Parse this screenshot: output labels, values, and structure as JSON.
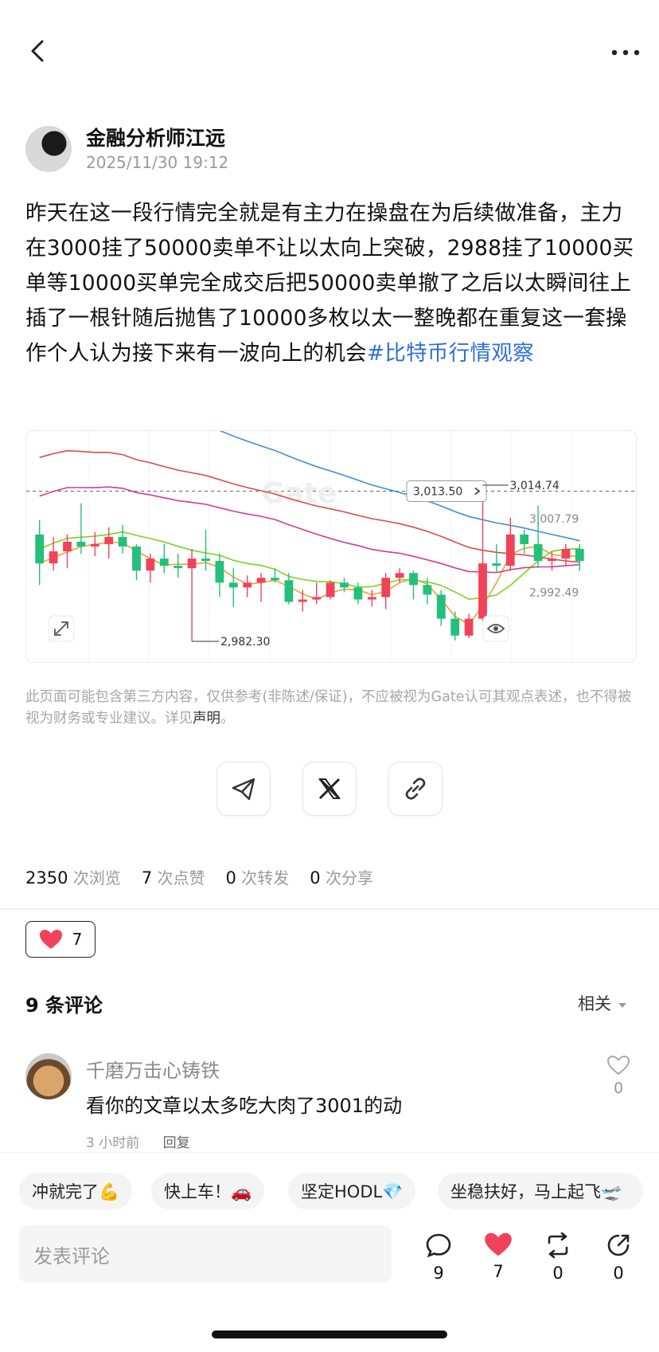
{
  "post": {
    "author": "金融分析师江远",
    "date": "2025/11/30 19:12",
    "body": "昨天在这一段行情完全就是有主力在操盘在为后续做准备，主力在3000挂了50000卖单不让以太向上突破，2988挂了10000买单等10000买单完全成交后把50000卖单撤了之后以太瞬间往上插了一根针随后抛售了10000多枚以太一整晚都在重复这一套操作个人认为接下来有一波向上的机会",
    "hashtag": "#比特币行情观察"
  },
  "chart_data": {
    "type": "candlestick",
    "watermark": "Gate",
    "price_labels": {
      "current_box": "3,013.50",
      "high": "3,014.74",
      "upper": "3,007.79",
      "lower": "2,992.49",
      "low": "2,982.30"
    },
    "ylim": [
      2978,
      3026
    ],
    "candles": [
      {
        "o": 3004.5,
        "c": 2998.5,
        "h": 3007.5,
        "l": 2994.0
      },
      {
        "o": 2998.5,
        "c": 3001.0,
        "h": 3004.0,
        "l": 2997.0
      },
      {
        "o": 3001.0,
        "c": 3003.0,
        "h": 3004.5,
        "l": 2997.5
      },
      {
        "o": 3003.0,
        "c": 3002.0,
        "h": 3011.0,
        "l": 3000.5
      },
      {
        "o": 3002.0,
        "c": 3002.5,
        "h": 3005.0,
        "l": 3000.0
      },
      {
        "o": 3002.5,
        "c": 3004.0,
        "h": 3006.0,
        "l": 2999.5
      },
      {
        "o": 3004.0,
        "c": 3002.0,
        "h": 3006.5,
        "l": 3000.5
      },
      {
        "o": 3002.0,
        "c": 2997.0,
        "h": 3002.5,
        "l": 2995.0
      },
      {
        "o": 2997.0,
        "c": 2999.5,
        "h": 3000.5,
        "l": 2994.5
      },
      {
        "o": 2999.5,
        "c": 2998.0,
        "h": 3002.5,
        "l": 2996.5
      },
      {
        "o": 2998.0,
        "c": 2997.5,
        "h": 3000.5,
        "l": 2995.5
      },
      {
        "o": 2997.5,
        "c": 2999.5,
        "h": 3001.5,
        "l": 2982.3
      },
      {
        "o": 2999.5,
        "c": 2999.0,
        "h": 3005.5,
        "l": 2997.0
      },
      {
        "o": 2999.0,
        "c": 2994.5,
        "h": 3000.5,
        "l": 2991.5
      },
      {
        "o": 2994.5,
        "c": 2993.5,
        "h": 2997.5,
        "l": 2989.5
      },
      {
        "o": 2993.5,
        "c": 2994.5,
        "h": 2996.0,
        "l": 2991.5
      },
      {
        "o": 2994.5,
        "c": 2995.5,
        "h": 2996.5,
        "l": 2990.5
      },
      {
        "o": 2995.5,
        "c": 2995.0,
        "h": 2997.5,
        "l": 2994.5
      },
      {
        "o": 2995.0,
        "c": 2990.5,
        "h": 2996.5,
        "l": 2990.0
      },
      {
        "o": 2990.5,
        "c": 2991.0,
        "h": 2993.0,
        "l": 2988.5
      },
      {
        "o": 2991.0,
        "c": 2991.5,
        "h": 2994.5,
        "l": 2990.0
      },
      {
        "o": 2991.5,
        "c": 2994.5,
        "h": 2995.0,
        "l": 2991.0
      },
      {
        "o": 2994.5,
        "c": 2993.5,
        "h": 2995.5,
        "l": 2992.5
      },
      {
        "o": 2993.5,
        "c": 2991.0,
        "h": 2994.5,
        "l": 2990.0
      },
      {
        "o": 2991.0,
        "c": 2991.5,
        "h": 2993.0,
        "l": 2989.5
      },
      {
        "o": 2991.5,
        "c": 2995.5,
        "h": 2996.5,
        "l": 2989.0
      },
      {
        "o": 2995.5,
        "c": 2996.5,
        "h": 2997.5,
        "l": 2994.5
      },
      {
        "o": 2996.5,
        "c": 2994.0,
        "h": 2997.0,
        "l": 2991.0
      },
      {
        "o": 2994.0,
        "c": 2992.0,
        "h": 2995.5,
        "l": 2990.0
      },
      {
        "o": 2992.0,
        "c": 2987.0,
        "h": 2993.0,
        "l": 2985.5
      },
      {
        "o": 2987.0,
        "c": 2983.5,
        "h": 2988.5,
        "l": 2982.5
      },
      {
        "o": 2983.5,
        "c": 2987.0,
        "h": 2988.0,
        "l": 2983.0
      },
      {
        "o": 2987.0,
        "c": 2998.5,
        "h": 3014.74,
        "l": 2986.5
      },
      {
        "o": 2998.5,
        "c": 2998.0,
        "h": 3002.5,
        "l": 2996.5
      },
      {
        "o": 2998.0,
        "c": 3004.5,
        "h": 3008.0,
        "l": 2997.0
      },
      {
        "o": 3004.5,
        "c": 3002.5,
        "h": 3005.5,
        "l": 3000.5
      },
      {
        "o": 3002.5,
        "c": 2999.0,
        "h": 3010.5,
        "l": 2997.5
      },
      {
        "o": 2999.0,
        "c": 2999.5,
        "h": 3001.0,
        "l": 2997.0
      },
      {
        "o": 2999.5,
        "c": 3001.5,
        "h": 3002.5,
        "l": 2998.0
      },
      {
        "o": 3001.5,
        "c": 2999.0,
        "h": 3002.5,
        "l": 2997.0
      }
    ],
    "colors": {
      "up": "#f0435a",
      "down": "#22c07a",
      "ma_blue": "#3f8fd4",
      "ma_red": "#d94b4b",
      "ma_pink": "#d43d8f",
      "ma_green": "#7ed321",
      "ma_orange": "#e8a23a"
    }
  },
  "disclaimer": {
    "text": "此页面可能包含第三方内容，仅供参考(非陈述/保证)，不应被视为Gate认可其观点表述，也不得被视为财务或专业建议。详见",
    "link": "声明",
    "end": "。"
  },
  "share": [
    "telegram-icon",
    "x-icon",
    "link-icon"
  ],
  "stats": [
    {
      "num": "2350",
      "label": "次浏览"
    },
    {
      "num": "7",
      "label": "次点赞"
    },
    {
      "num": "0",
      "label": "次转发"
    },
    {
      "num": "0",
      "label": "次分享"
    }
  ],
  "reaction": {
    "count": "7"
  },
  "comments": {
    "title": "9 条评论",
    "sort": "相关",
    "items": [
      {
        "name": "千磨万击心铸铁",
        "text": "看你的文章以太多吃大肉了3001的动",
        "time": "3 小时前",
        "reply": "回复",
        "likes": "0"
      }
    ]
  },
  "quick_replies": [
    "冲就完了💪",
    "快上车！🚗",
    "坚定HODL💎",
    "坐稳扶好，马上起飞🛫"
  ],
  "composer": {
    "placeholder": "发表评论"
  },
  "actions": [
    {
      "icon": "comment-icon",
      "count": "9"
    },
    {
      "icon": "heart-icon",
      "count": "7"
    },
    {
      "icon": "repost-icon",
      "count": "0"
    },
    {
      "icon": "share-icon",
      "count": "0"
    }
  ],
  "accent": "#f0435a"
}
